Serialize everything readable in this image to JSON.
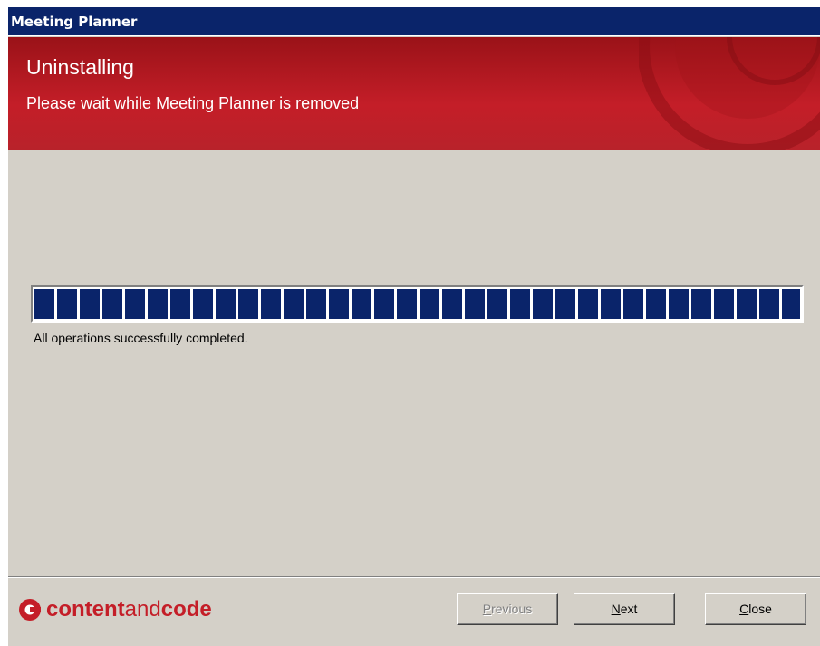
{
  "window": {
    "title": "Meeting Planner"
  },
  "banner": {
    "title": "Uninstalling",
    "subtitle": "Please wait while Meeting Planner is removed"
  },
  "progress": {
    "value_percent": 100,
    "status": "All operations successfully completed."
  },
  "footer": {
    "logo": {
      "part1": "content",
      "part2": "and",
      "part3": "code"
    },
    "buttons": {
      "previous": {
        "mnemonic": "P",
        "rest": "revious",
        "enabled": false
      },
      "next": {
        "mnemonic": "N",
        "rest": "ext",
        "enabled": true
      },
      "close": {
        "mnemonic": "C",
        "rest": "lose",
        "enabled": true
      }
    }
  },
  "colors": {
    "titlebar": "#0a246a",
    "banner": "#c41e28",
    "dialog_bg": "#d4d0c8",
    "progress": "#0a246a"
  }
}
